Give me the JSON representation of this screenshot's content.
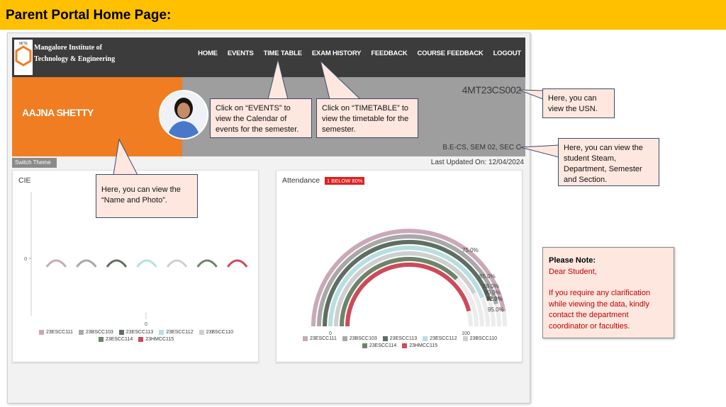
{
  "slide": {
    "title": "Parent Portal Home Page:"
  },
  "portal": {
    "logo": {
      "abbr": "MITE",
      "name_line1": "Mangalore Institute of",
      "name_line2": "Technology & Engineering"
    },
    "nav": [
      "HOME",
      "EVENTS",
      "TIME TABLE",
      "EXAM HISTORY",
      "FEEDBACK",
      "COURSE FEEDBACK",
      "LOGOUT"
    ],
    "student": {
      "name": "AAJNA SHETTY",
      "usn": "4MT23CS002",
      "dept": "B.E-CS, SEM 02, SEC C"
    },
    "switch_theme": "Switch Theme",
    "last_updated": "Last Updated On: 12/04/2024",
    "cie": {
      "title": "CIE"
    },
    "attendance": {
      "title": "Attendance",
      "badge": "1 BELOW 80%"
    }
  },
  "chart_data": [
    {
      "type": "bar",
      "title": "CIE",
      "categories": [
        "23ESCC111",
        "23BSCC103",
        "23ESCC113",
        "23ESCC112",
        "23BSCC110",
        "23ESCC114",
        "23HMCC115"
      ],
      "values": [
        0,
        0,
        0,
        0,
        0,
        0,
        0
      ],
      "yticks": [
        "0"
      ],
      "xticks": [
        "0"
      ],
      "legend": "bottom"
    },
    {
      "type": "radial-bar",
      "title": "Attendance",
      "categories": [
        "23ESCC111",
        "23BSCC103",
        "23ESCC113",
        "23ESCC112",
        "23BSCC110",
        "23ESCC114",
        "23HMCC115"
      ],
      "values": [
        95.0,
        92.0,
        90.0,
        88.0,
        85.0,
        75.0,
        92.0
      ],
      "value_labels": [
        "75.0%",
        "85.0%",
        "88.0%",
        "90.0%",
        "92.0%",
        "92.0%",
        "95.0%"
      ],
      "axis_min_label": "0",
      "axis_max_label": "100",
      "range": [
        0,
        100
      ],
      "legend": "bottom"
    }
  ],
  "colors": {
    "series": [
      "#c9a9b8",
      "#a8a8a8",
      "#5f6e62",
      "#b7dfe0",
      "#cfcfcf",
      "#6e8469",
      "#cc4b5a"
    ],
    "header_bar": "#ffc000",
    "banner_orange": "#f07d22",
    "banner_gray": "#9e9e9e",
    "badge_red": "#e0201f"
  },
  "callouts": {
    "usn": "Here, you can view the USN.",
    "dept": "Here, you can view the student Steam, Department, Semester and Section.",
    "events": "Click on “EVENTS” to view the Calendar of events for the semester.",
    "timetable": "Click on “TIMETABLE” to view the timetable for the semester.",
    "name_photo": "Here, you can view the “Name and Photo”."
  },
  "note": {
    "heading": "Please Note:",
    "greeting": "Dear Student,",
    "body": "If you require any clarification while viewing the data, kindly contact the department coordinator or faculties."
  }
}
